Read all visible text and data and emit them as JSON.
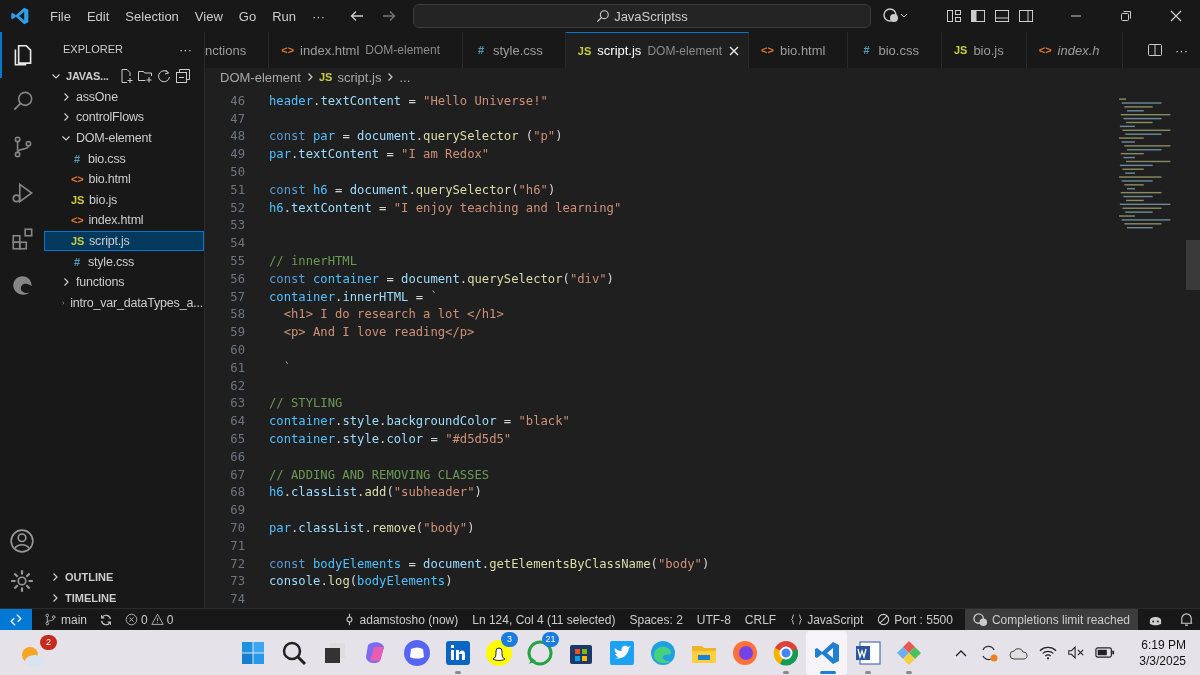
{
  "title_bar": {
    "menus": [
      "File",
      "Edit",
      "Selection",
      "View",
      "Go",
      "Run",
      "···"
    ],
    "command_center": "JavaScriptss"
  },
  "activity_bar": {
    "items": [
      {
        "selected": true
      },
      {
        "selected": false
      },
      {
        "selected": false
      },
      {
        "selected": false
      },
      {
        "selected": false
      },
      {
        "selected": false
      }
    ]
  },
  "explorer": {
    "title": "EXPLORER",
    "more": "···",
    "tree": [
      {
        "name": "JAVAS...",
        "kind": "folder",
        "expanded": true,
        "selected": false,
        "children": [
          {
            "name": "assOne",
            "kind": "folder",
            "expanded": false,
            "selected": false
          },
          {
            "name": "controlFlows",
            "kind": "folder",
            "expanded": false,
            "selected": false
          },
          {
            "name": "DOM-element",
            "kind": "folder",
            "expanded": true,
            "selected": false,
            "children": [
              {
                "name": "bio.css",
                "kind": "file",
                "color": "#519aba",
                "icon": "#",
                "selected": false
              },
              {
                "name": "bio.html",
                "kind": "file",
                "color": "#e37933",
                "icon": "<>",
                "selected": false
              },
              {
                "name": "bio.js",
                "kind": "file",
                "color": "#cbcb41",
                "icon": "JS",
                "selected": false
              },
              {
                "name": "index.html",
                "kind": "file",
                "color": "#e37933",
                "icon": "<>",
                "selected": false
              },
              {
                "name": "script.js",
                "kind": "file",
                "color": "#cbcb41",
                "icon": "JS",
                "selected": true
              },
              {
                "name": "style.css",
                "kind": "file",
                "color": "#519aba",
                "icon": "#",
                "selected": false
              }
            ]
          },
          {
            "name": "functions",
            "kind": "folder",
            "expanded": false,
            "selected": false
          },
          {
            "name": "intro_var_dataTypes_a...",
            "kind": "folder",
            "expanded": false,
            "selected": false
          }
        ]
      }
    ],
    "sections": [
      {
        "name": "OUTLINE",
        "expanded": false
      },
      {
        "name": "TIMELINE",
        "expanded": false
      }
    ]
  },
  "tabs": [
    {
      "label": "nctions",
      "selected": false,
      "preview": false
    },
    {
      "label": "index.html",
      "detail": "DOM-element",
      "icon": "<>",
      "color": "#e37933",
      "selected": false,
      "preview": false
    },
    {
      "label": "style.css",
      "icon": "#",
      "color": "#519aba",
      "selected": false,
      "preview": false
    },
    {
      "label": "script.js",
      "detail": "DOM-element",
      "icon": "JS",
      "color": "#cbcb41",
      "selected": true,
      "preview": false
    },
    {
      "label": "bio.html",
      "icon": "<>",
      "color": "#e37933",
      "selected": false,
      "preview": false
    },
    {
      "label": "bio.css",
      "icon": "#",
      "color": "#519aba",
      "selected": false,
      "preview": false
    },
    {
      "label": "bio.js",
      "icon": "JS",
      "color": "#cbcb41",
      "selected": false,
      "preview": false
    },
    {
      "label": "index.h",
      "icon": "<>",
      "color": "#e37933",
      "selected": false,
      "preview": true
    }
  ],
  "tab_actions": {
    "more": "···"
  },
  "breadcrumbs": [
    {
      "text": "DOM-element"
    },
    {
      "text": "script.js",
      "icon": "JS",
      "color": "#cbcb41"
    },
    {
      "text": "..."
    }
  ],
  "code": {
    "lines": [
      {
        "number": "46",
        "tokens": [
          {
            "text": "header",
            "kind": "const"
          },
          {
            "text": ".",
            "kind": "op"
          },
          {
            "text": "textContent",
            "kind": "var"
          },
          {
            "text": " = ",
            "kind": "op"
          },
          {
            "text": "\"Hello Universe!\"",
            "kind": "str"
          }
        ]
      },
      {
        "number": "47"
      },
      {
        "number": "48",
        "tokens": [
          {
            "text": "const ",
            "kind": "kw"
          },
          {
            "text": "par",
            "kind": "const"
          },
          {
            "text": " = ",
            "kind": "op"
          },
          {
            "text": "document",
            "kind": "var"
          },
          {
            "text": ".",
            "kind": "op"
          },
          {
            "text": "querySelector",
            "kind": "fn"
          },
          {
            "text": " (",
            "kind": "op"
          },
          {
            "text": "\"p\"",
            "kind": "str"
          },
          {
            "text": ")",
            "kind": "op"
          }
        ]
      },
      {
        "number": "49",
        "tokens": [
          {
            "text": "par",
            "kind": "const"
          },
          {
            "text": ".",
            "kind": "op"
          },
          {
            "text": "textContent",
            "kind": "var"
          },
          {
            "text": " = ",
            "kind": "op"
          },
          {
            "text": "\"I am Redox\"",
            "kind": "str"
          }
        ]
      },
      {
        "number": "50"
      },
      {
        "number": "51",
        "tokens": [
          {
            "text": "const ",
            "kind": "kw"
          },
          {
            "text": "h6",
            "kind": "const"
          },
          {
            "text": " = ",
            "kind": "op"
          },
          {
            "text": "document",
            "kind": "var"
          },
          {
            "text": ".",
            "kind": "op"
          },
          {
            "text": "querySelector",
            "kind": "fn"
          },
          {
            "text": "(",
            "kind": "op"
          },
          {
            "text": "\"h6\"",
            "kind": "str"
          },
          {
            "text": ")",
            "kind": "op"
          }
        ]
      },
      {
        "number": "52",
        "tokens": [
          {
            "text": "h6",
            "kind": "const"
          },
          {
            "text": ".",
            "kind": "op"
          },
          {
            "text": "textContent",
            "kind": "var"
          },
          {
            "text": " = ",
            "kind": "op"
          },
          {
            "text": "\"I enjoy teaching and learning\"",
            "kind": "str"
          }
        ]
      },
      {
        "number": "53"
      },
      {
        "number": "54"
      },
      {
        "number": "55",
        "tokens": [
          {
            "text": "// innerHTML",
            "kind": "cm"
          }
        ]
      },
      {
        "number": "56",
        "tokens": [
          {
            "text": "const ",
            "kind": "kw"
          },
          {
            "text": "container",
            "kind": "const"
          },
          {
            "text": " = ",
            "kind": "op"
          },
          {
            "text": "document",
            "kind": "var"
          },
          {
            "text": ".",
            "kind": "op"
          },
          {
            "text": "querySelector",
            "kind": "fn"
          },
          {
            "text": "(",
            "kind": "op"
          },
          {
            "text": "\"div\"",
            "kind": "str"
          },
          {
            "text": ")",
            "kind": "op"
          }
        ]
      },
      {
        "number": "57",
        "tokens": [
          {
            "text": "container",
            "kind": "const"
          },
          {
            "text": ".",
            "kind": "op"
          },
          {
            "text": "innerHTML",
            "kind": "var"
          },
          {
            "text": " = ",
            "kind": "op"
          },
          {
            "text": "`",
            "kind": "str"
          }
        ]
      },
      {
        "number": "58",
        "tokens": [
          {
            "text": "  <h1> I do research a lot </h1>",
            "kind": "str"
          }
        ]
      },
      {
        "number": "59",
        "tokens": [
          {
            "text": "  <p> And I love reading</p>",
            "kind": "str"
          }
        ]
      },
      {
        "number": "60"
      },
      {
        "number": "61",
        "tokens": [
          {
            "text": "  `",
            "kind": "str"
          }
        ]
      },
      {
        "number": "62"
      },
      {
        "number": "63",
        "tokens": [
          {
            "text": "// STYLING",
            "kind": "cm"
          }
        ]
      },
      {
        "number": "64",
        "tokens": [
          {
            "text": "container",
            "kind": "const"
          },
          {
            "text": ".",
            "kind": "op"
          },
          {
            "text": "style",
            "kind": "var"
          },
          {
            "text": ".",
            "kind": "op"
          },
          {
            "text": "backgroundColor",
            "kind": "var"
          },
          {
            "text": " = ",
            "kind": "op"
          },
          {
            "text": "\"black\"",
            "kind": "str"
          }
        ]
      },
      {
        "number": "65",
        "tokens": [
          {
            "text": "container",
            "kind": "const"
          },
          {
            "text": ".",
            "kind": "op"
          },
          {
            "text": "style",
            "kind": "var"
          },
          {
            "text": ".",
            "kind": "op"
          },
          {
            "text": "color",
            "kind": "var"
          },
          {
            "text": " = ",
            "kind": "op"
          },
          {
            "text": "\"#d5d5d5\"",
            "kind": "str"
          }
        ]
      },
      {
        "number": "66"
      },
      {
        "number": "67",
        "tokens": [
          {
            "text": "// ADDING AND REMOVING CLASSES",
            "kind": "cm"
          }
        ]
      },
      {
        "number": "68",
        "tokens": [
          {
            "text": "h6",
            "kind": "const"
          },
          {
            "text": ".",
            "kind": "op"
          },
          {
            "text": "classList",
            "kind": "var"
          },
          {
            "text": ".",
            "kind": "op"
          },
          {
            "text": "add",
            "kind": "fn"
          },
          {
            "text": "(",
            "kind": "op"
          },
          {
            "text": "\"subheader\"",
            "kind": "str"
          },
          {
            "text": ")",
            "kind": "op"
          }
        ]
      },
      {
        "number": "69"
      },
      {
        "number": "70",
        "tokens": [
          {
            "text": "par",
            "kind": "const"
          },
          {
            "text": ".",
            "kind": "op"
          },
          {
            "text": "classList",
            "kind": "var"
          },
          {
            "text": ".",
            "kind": "op"
          },
          {
            "text": "remove",
            "kind": "fn"
          },
          {
            "text": "(",
            "kind": "op"
          },
          {
            "text": "\"body\"",
            "kind": "str"
          },
          {
            "text": ")",
            "kind": "op"
          }
        ]
      },
      {
        "number": "71"
      },
      {
        "number": "72",
        "tokens": [
          {
            "text": "const ",
            "kind": "kw"
          },
          {
            "text": "bodyElements",
            "kind": "const"
          },
          {
            "text": " = ",
            "kind": "op"
          },
          {
            "text": "document",
            "kind": "var"
          },
          {
            "text": ".",
            "kind": "op"
          },
          {
            "text": "getElementsByClassName",
            "kind": "fn"
          },
          {
            "text": "(",
            "kind": "op"
          },
          {
            "text": "\"body\"",
            "kind": "str"
          },
          {
            "text": ")",
            "kind": "op"
          }
        ]
      },
      {
        "number": "73",
        "tokens": [
          {
            "text": "console",
            "kind": "var"
          },
          {
            "text": ".",
            "kind": "op"
          },
          {
            "text": "log",
            "kind": "fn"
          },
          {
            "text": "(",
            "kind": "op"
          },
          {
            "text": "bodyElements",
            "kind": "const"
          },
          {
            "text": ")",
            "kind": "op"
          }
        ]
      },
      {
        "number": "74"
      }
    ]
  },
  "status_bar": {
    "branch": "main",
    "errors": "0",
    "warnings": "0",
    "right": [
      {
        "kind": "commit",
        "text": "adamstosho (now)",
        "highlighted": false
      },
      {
        "kind": "plain",
        "text": "Ln 124, Col 4 (11 selected)",
        "highlighted": false
      },
      {
        "kind": "plain",
        "text": "Spaces: 2",
        "highlighted": false
      },
      {
        "kind": "plain",
        "text": "UTF-8",
        "highlighted": false
      },
      {
        "kind": "plain",
        "text": "CRLF",
        "highlighted": false
      },
      {
        "kind": "language",
        "text": "JavaScript",
        "highlighted": false
      },
      {
        "kind": "port",
        "text": "Port : 5500",
        "highlighted": false
      },
      {
        "kind": "copilot",
        "text": "Completions limit reached",
        "highlighted": true
      }
    ]
  },
  "taskbar": {
    "weather_badge": "2",
    "apps": [
      {
        "running": false,
        "active": false
      },
      {
        "running": false,
        "active": false
      },
      {
        "running": false,
        "active": false
      },
      {
        "running": false,
        "active": false
      },
      {
        "running": false,
        "active": false
      },
      {
        "running": true,
        "active": false
      },
      {
        "running": false,
        "active": false,
        "badge": "3"
      },
      {
        "running": false,
        "active": false,
        "badge": "21"
      },
      {
        "running": false,
        "active": false
      },
      {
        "running": false,
        "active": false
      },
      {
        "running": false,
        "active": false
      },
      {
        "running": false,
        "active": false
      },
      {
        "running": false,
        "active": false
      },
      {
        "running": true,
        "active": false
      },
      {
        "running": true,
        "active": true
      },
      {
        "running": true,
        "active": false
      },
      {
        "running": true,
        "active": false
      }
    ],
    "time": "6:19 PM",
    "date": "3/3/2025"
  }
}
